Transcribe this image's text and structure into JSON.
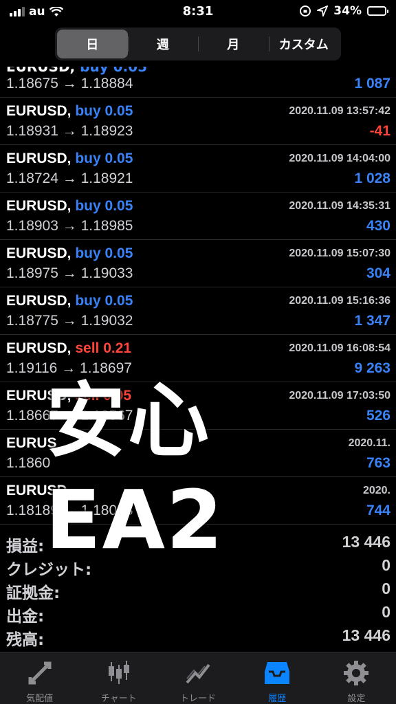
{
  "status_bar": {
    "carrier": "au",
    "time": "8:31",
    "battery": "34%"
  },
  "period_tabs": [
    {
      "label": "日",
      "active": true
    },
    {
      "label": "週",
      "active": false
    },
    {
      "label": "月",
      "active": false
    },
    {
      "label": "カスタム",
      "active": false
    }
  ],
  "partial_row": {
    "symbol": "EURUSD,",
    "side": "buy 0.05",
    "prices": "1.18675 → 1.18884",
    "profit": "1 087"
  },
  "trades": [
    {
      "symbol": "EURUSD,",
      "side": "buy 0.05",
      "type": "buy",
      "date": "2020.11.09 13:57:42",
      "prices": "1.18931 → 1.18923",
      "profit": "-41",
      "sign": "neg"
    },
    {
      "symbol": "EURUSD,",
      "side": "buy 0.05",
      "type": "buy",
      "date": "2020.11.09 14:04:00",
      "prices": "1.18724 → 1.18921",
      "profit": "1 028",
      "sign": "pos"
    },
    {
      "symbol": "EURUSD,",
      "side": "buy 0.05",
      "type": "buy",
      "date": "2020.11.09 14:35:31",
      "prices": "1.18903 → 1.18985",
      "profit": "430",
      "sign": "pos"
    },
    {
      "symbol": "EURUSD,",
      "side": "buy 0.05",
      "type": "buy",
      "date": "2020.11.09 15:07:30",
      "prices": "1.18975 → 1.19033",
      "profit": "304",
      "sign": "pos"
    },
    {
      "symbol": "EURUSD,",
      "side": "buy 0.05",
      "type": "buy",
      "date": "2020.11.09 15:16:36",
      "prices": "1.18775 → 1.19032",
      "profit": "1 347",
      "sign": "pos"
    },
    {
      "symbol": "EURUSD,",
      "side": "sell 0.21",
      "type": "sell",
      "date": "2020.11.09 16:08:54",
      "prices": "1.19116 → 1.18697",
      "profit": "9 263",
      "sign": "pos"
    },
    {
      "symbol": "EURUSD,",
      "side": "sell 0.05",
      "type": "sell",
      "date": "2020.11.09 17:03:50",
      "prices": "1.18667 → 1.18567",
      "profit": "526",
      "sign": "pos"
    },
    {
      "symbol": "EURUS",
      "side": "",
      "type": "sell",
      "date": "2020.11.",
      "prices": "1.1860",
      "profit": "763",
      "sign": "pos"
    },
    {
      "symbol": "EURUSD",
      "side": "",
      "type": "sell",
      "date": "2020.",
      "prices": "1.18189 → 1.18048",
      "profit": "744",
      "sign": "pos"
    }
  ],
  "summary": [
    {
      "label": "損益:",
      "value": "13 446"
    },
    {
      "label": "クレジット:",
      "value": "0"
    },
    {
      "label": "証拠金:",
      "value": "0"
    },
    {
      "label": "出金:",
      "value": "0"
    },
    {
      "label": "残高:",
      "value": "13 446"
    }
  ],
  "overlay_text": "安心EA2",
  "bottom_tabs": [
    {
      "label": "気配値",
      "icon": "quotes-icon",
      "active": false
    },
    {
      "label": "チャート",
      "icon": "chart-icon",
      "active": false
    },
    {
      "label": "トレード",
      "icon": "trade-icon",
      "active": false
    },
    {
      "label": "履歴",
      "icon": "history-icon",
      "active": true
    },
    {
      "label": "設定",
      "icon": "settings-icon",
      "active": false
    }
  ],
  "colors": {
    "buy": "#3a82f7",
    "sell": "#ff453a",
    "active_tab": "#0a84ff",
    "background": "#000000"
  }
}
